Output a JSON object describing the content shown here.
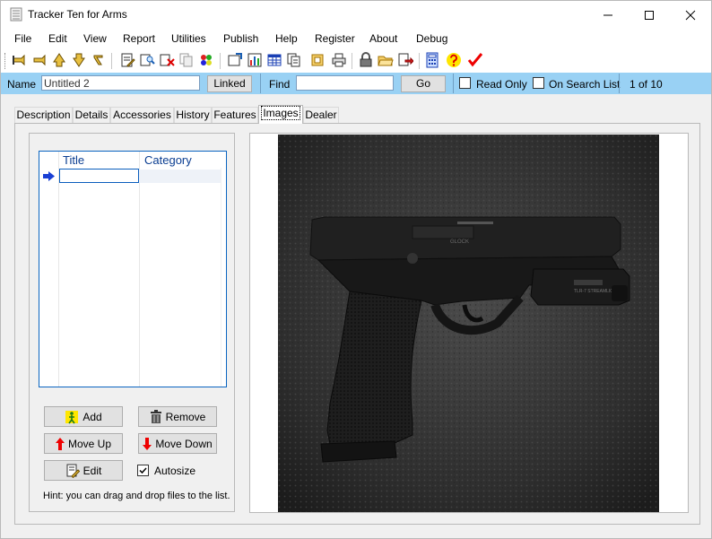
{
  "window": {
    "title": "Tracker Ten for Arms"
  },
  "menu": [
    "File",
    "Edit",
    "View",
    "Report",
    "Utilities",
    "Publish",
    "Help",
    "Register",
    "About",
    "Debug"
  ],
  "toolbar": {
    "icons": [
      "first-record-icon",
      "previous-record-icon",
      "new-record-icon",
      "next-record-icon",
      "last-record-icon",
      "edit-record-icon",
      "find-icon",
      "delete-record-icon",
      "copy-record-icon",
      "import-icon",
      "report-icon",
      "chart-icon",
      "table-view-icon",
      "copy-icon",
      "layout-icon",
      "print-icon",
      "lock-icon",
      "open-folder-icon",
      "export-icon",
      "calculator-icon",
      "help-icon",
      "check-icon"
    ]
  },
  "namebar": {
    "name_label": "Name",
    "name_value": "Untitled 2",
    "linked_label": "Linked",
    "find_label": "Find",
    "find_value": "",
    "go_label": "Go",
    "read_only_label": "Read Only",
    "read_only_checked": false,
    "search_list_label": "On Search List",
    "search_list_checked": false,
    "record_position": "1 of 10"
  },
  "tabs": [
    "Description",
    "Details",
    "Accessories",
    "History",
    "Features",
    "Images",
    "Dealer"
  ],
  "active_tab": "Images",
  "images_tab": {
    "grid": {
      "columns": [
        "Title",
        "Category"
      ],
      "rows": [
        {
          "title": "",
          "category": ""
        }
      ]
    },
    "buttons": {
      "add": "Add",
      "remove": "Remove",
      "move_up": "Move Up",
      "move_down": "Move Down",
      "edit": "Edit"
    },
    "autosize_label": "Autosize",
    "autosize_checked": true,
    "hint": "Hint: you can drag and drop files to the list.",
    "preview_image_text": {
      "slide": "GLOCK",
      "light": "TLR-7 STREAMLIGHT"
    }
  },
  "colors": {
    "namebar_bg": "#99d1f4",
    "grid_border": "#0a64c0",
    "header_text": "#0a3d91"
  }
}
